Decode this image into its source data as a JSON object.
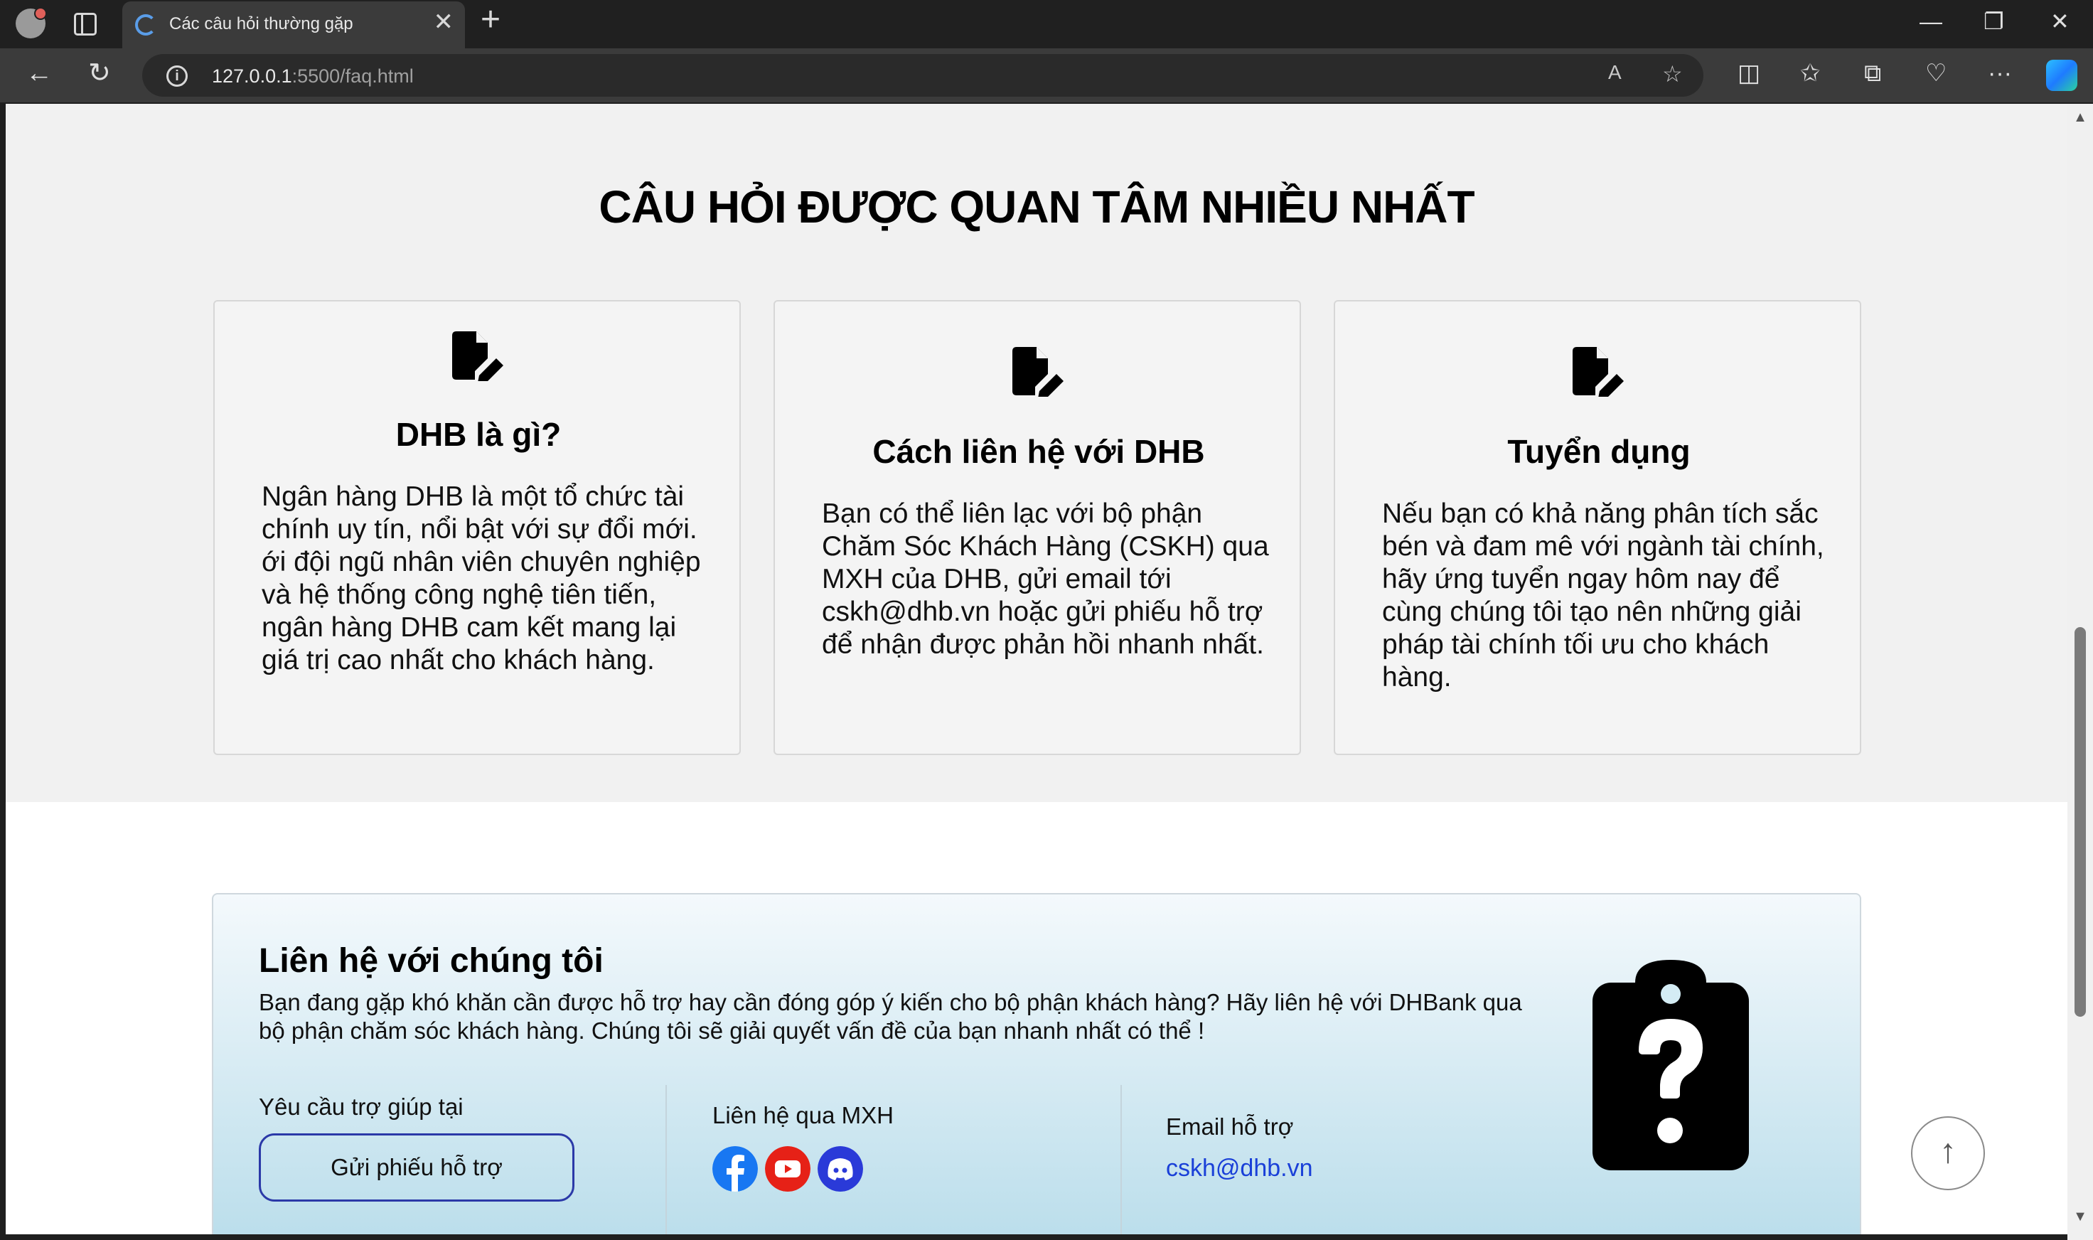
{
  "browser": {
    "tab_title": "Các câu hỏi thường gặp",
    "url_host": "127.0.0.1",
    "url_rest": ":5500/faq.html",
    "read_aloud": "A",
    "buttons": {
      "close_tab": "✕",
      "new_tab": "+",
      "minimize": "—",
      "restore": "❐",
      "close_window": "✕",
      "back": "←",
      "reload": "↻",
      "more": "···"
    }
  },
  "faq": {
    "title": "CÂU HỎI ĐƯỢC QUAN TÂM NHIỀU NHẤT",
    "cards": [
      {
        "title": "DHB là gì?",
        "body": "Ngân hàng DHB là một tổ chức tài chính uy tín, nổi bật với sự đổi mới. ới đội ngũ nhân viên chuyên nghiệp và hệ thống công nghệ tiên tiến, ngân hàng DHB cam kết mang lại giá trị cao nhất cho khách hàng."
      },
      {
        "title": "Cách liên hệ với DHB",
        "body": "Bạn có thể liên lạc với bộ phận Chăm Sóc Khách Hàng (CSKH) qua MXH của DHB, gửi email tới cskh@dhb.vn hoặc gửi phiếu hỗ trợ để nhận được phản hồi nhanh nhất."
      },
      {
        "title": "Tuyển dụng",
        "body": "Nếu bạn có khả năng phân tích sắc bén và đam mê với ngành tài chính, hãy ứng tuyển ngay hôm nay để cùng chúng tôi tạo nên những giải pháp tài chính tối ưu cho khách hàng."
      }
    ]
  },
  "contact": {
    "title": "Liên hệ với chúng tôi",
    "description": "Bạn đang gặp khó khăn cần được hỗ trợ hay cần đóng góp ý kiến cho bộ phận khách hàng? Hãy liên hệ với DHBank qua bộ phận chăm sóc khách hàng. Chúng tôi sẽ giải quyết vấn đề của bạn nhanh nhất có thể !",
    "help_label": "Yêu cầu trợ giúp tại",
    "help_button": "Gửi phiếu hỗ trợ",
    "social_label": "Liên hệ qua MXH",
    "social_icons": [
      "facebook-icon",
      "youtube-icon",
      "discord-icon"
    ],
    "email_label": "Email hỗ trợ",
    "email": "cskh@dhb.vn"
  },
  "colors": {
    "accent": "#2b39a8",
    "link": "#1a40d8",
    "facebook": "#1877f2",
    "youtube": "#e62117",
    "discord": "#2a3ad8"
  },
  "scroll_top": "↑"
}
